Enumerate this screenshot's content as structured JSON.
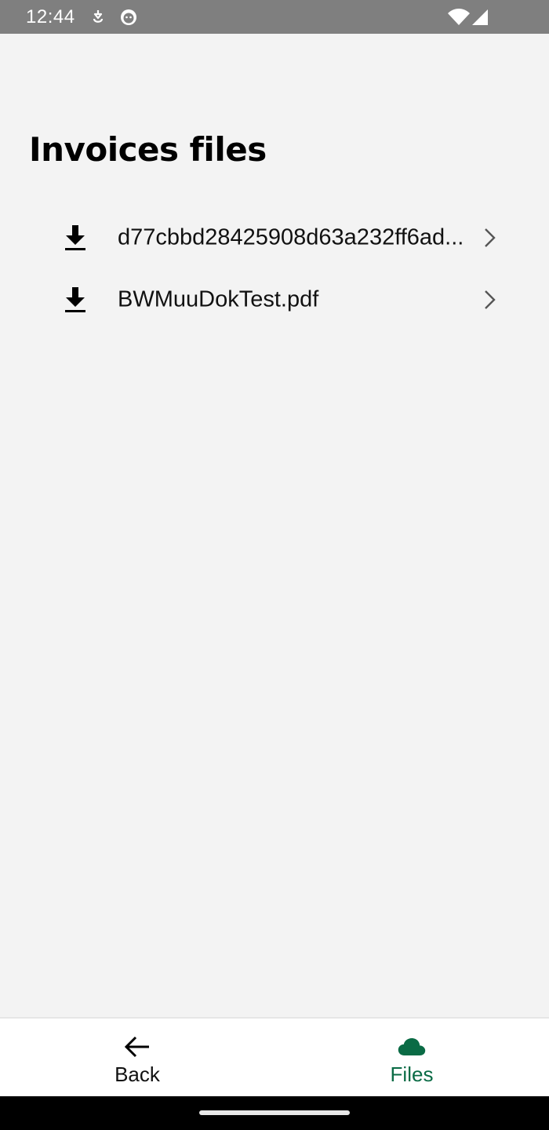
{
  "status_bar": {
    "time": "12:44",
    "icons": [
      "notification-icon",
      "cat-face-icon",
      "wifi-icon",
      "cell-signal-icon"
    ]
  },
  "page": {
    "title": "Invoices files"
  },
  "files": [
    {
      "name": "d77cbbd28425908d63a232ff6ad...",
      "icon": "download-icon"
    },
    {
      "name": "BWMuuDokTest.pdf",
      "icon": "download-icon"
    }
  ],
  "bottom_nav": {
    "back_label": "Back",
    "files_label": "Files",
    "active": "files"
  },
  "colors": {
    "accent": "#0a6b45",
    "background": "#f3f3f3",
    "status_bar": "#7f7f7f"
  }
}
